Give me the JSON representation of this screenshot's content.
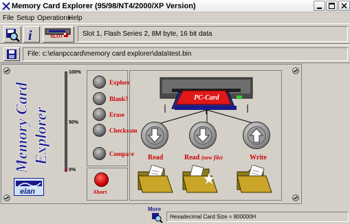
{
  "window": {
    "title": "Memory Card Explorer (95/98/NT4/2000/XP Version)"
  },
  "menu": {
    "items": [
      "File",
      "Setup",
      "Operations",
      "Help"
    ]
  },
  "toolbar": {
    "slot_button_label": "SLOT",
    "card_info": "Slot 1, Flash Series 2, 8M byte, 16 bit data",
    "file_info": "File: c:\\elanpccard\\memory card explorer\\data\\test.bin"
  },
  "logo": {
    "line1": "Memory Card",
    "line2": "Explorer",
    "brand": "elan"
  },
  "gauge": {
    "labels": [
      "100%",
      "50%",
      "0%"
    ],
    "level_percent": 3,
    "fill_color": "#e00000"
  },
  "operations": {
    "buttons": [
      {
        "label": "Explore",
        "icon": "round-button"
      },
      {
        "label": "Blank?",
        "icon": "round-button"
      },
      {
        "label": "Erase",
        "icon": "round-button"
      },
      {
        "label": "Checksum",
        "icon": "round-button"
      },
      {
        "label": "Compare",
        "icon": "round-button"
      }
    ],
    "abort_label": "Abort"
  },
  "device": {
    "card_label": "PC-Card",
    "actions": [
      {
        "label": "Read",
        "suffix": "",
        "icon": "arrow-down-icon"
      },
      {
        "label": "Read",
        "suffix": "(new file)",
        "icon": "arrow-down-icon"
      },
      {
        "label": "Write",
        "suffix": "",
        "icon": "arrow-up-icon"
      }
    ]
  },
  "status": {
    "more_label": "More",
    "card_size": "Hexadecimal Card Size = 800000H"
  },
  "colors": {
    "accent_red": "#cc0000",
    "card_red": "#e01818",
    "panel_bg": "#d4d0c8",
    "logo_blue": "#1a1a8c",
    "folder_yellow": "#c9a528"
  }
}
